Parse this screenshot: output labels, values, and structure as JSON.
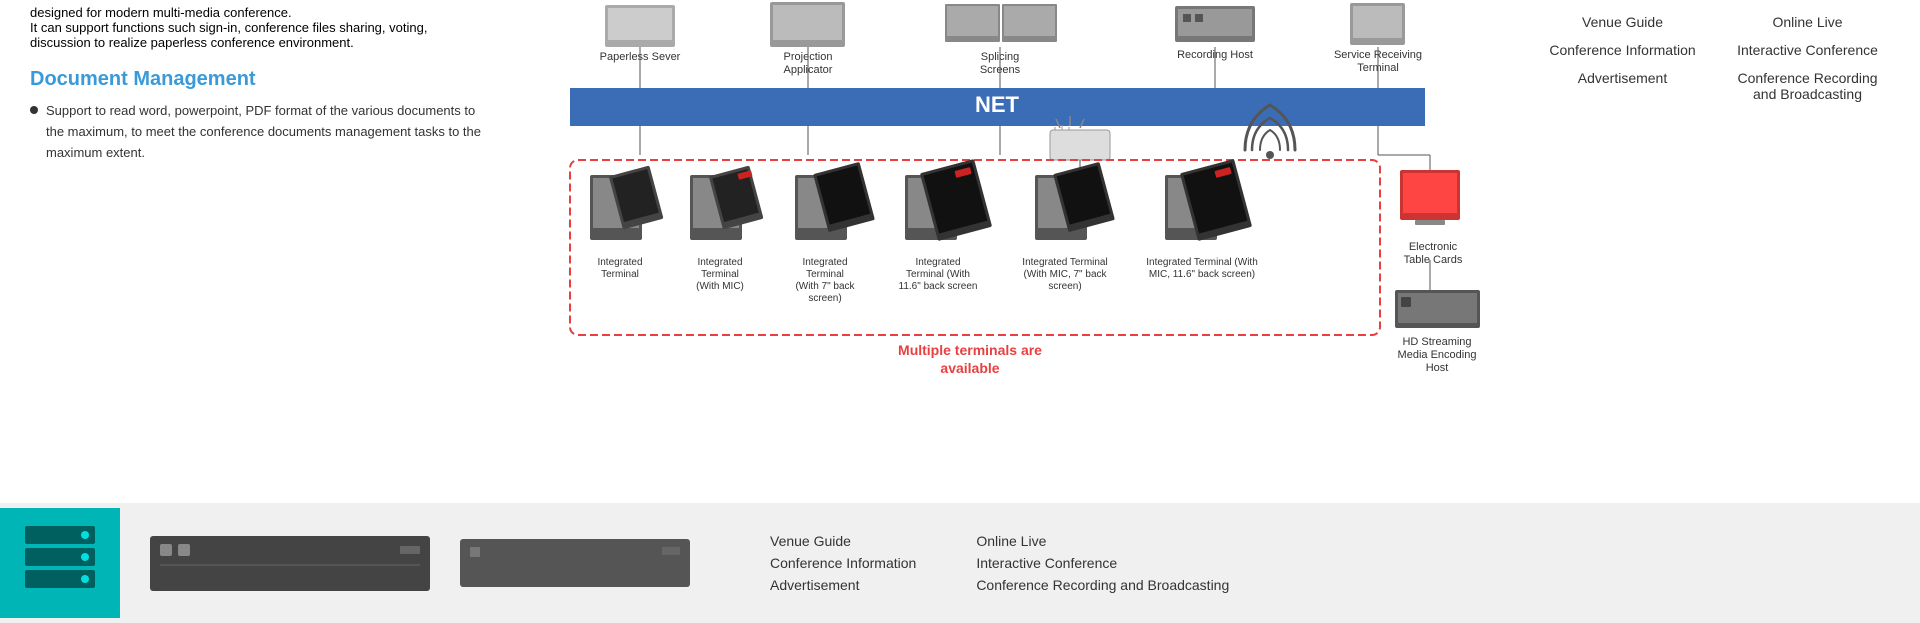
{
  "left": {
    "intro_text": "designed for modern multi-media conference.",
    "para2": "It can support functions such sign-in, conference files sharing, voting, discussion to realize paperless conference environment.",
    "section_title": "Document Management",
    "bullet_text": "Support to read word, powerpoint, PDF format of the various documents to the maximum, to meet the conference documents management tasks to the maximum extent."
  },
  "diagram": {
    "net_label": "NET",
    "top_devices": [
      {
        "label": "Paperless Sever",
        "id": "paperless-sever"
      },
      {
        "label": "Projection\nApplicator",
        "id": "projection-applicator"
      },
      {
        "label": "Splicing\nScreens",
        "id": "splicing-screens"
      },
      {
        "label": "Recording Host",
        "id": "recording-host"
      },
      {
        "label": "Service Receiving\nTerminal",
        "id": "service-receiving-terminal"
      }
    ],
    "terminals": [
      {
        "label": "Integrated\nTerminal",
        "id": "t1"
      },
      {
        "label": "Integrated\nTerminal\n(With MIC)",
        "id": "t2"
      },
      {
        "label": "Integrated\nTerminal\n(With 7\" back\nscreen)",
        "id": "t3"
      },
      {
        "label": "Integrated\nTerminal (With\n11.6\" back screen\n)",
        "id": "t4"
      },
      {
        "label": "Integrated Terminal\n(With MIC, 7\" back\nscreen)",
        "id": "t5"
      },
      {
        "label": "Integrated Terminal (With\nMIC, 11.6\" back screen)",
        "id": "t6"
      }
    ],
    "multiple_text_line1": "Multiple terminals are",
    "multiple_text_line2": "available",
    "right_extras": [
      {
        "label": "Electronic\nTable Cards",
        "id": "electronic-table-cards"
      },
      {
        "label": "HD Streaming\nMedia Encoding\nHost",
        "id": "hd-streaming"
      }
    ]
  },
  "right": {
    "col1": {
      "items": [
        "Venue Guide",
        "Conference Information",
        "Advertisement"
      ]
    },
    "col2": {
      "items": [
        "Online Live",
        "Interactive Conference",
        "Conference Recording and Broadcasting"
      ]
    }
  },
  "bottom": {
    "footer_col1": {
      "items": [
        "Venue Guide",
        "Conference Information",
        "Advertisement"
      ]
    },
    "footer_col2": {
      "items": [
        "Online Live",
        "Interactive Conference",
        "Conference Recording and Broadcasting"
      ]
    }
  },
  "colors": {
    "teal": "#00b5b5",
    "blue_bar": "#3a6db5",
    "red_dashed": "#e84040",
    "link_blue": "#3a9ad9",
    "dark": "#333333"
  }
}
